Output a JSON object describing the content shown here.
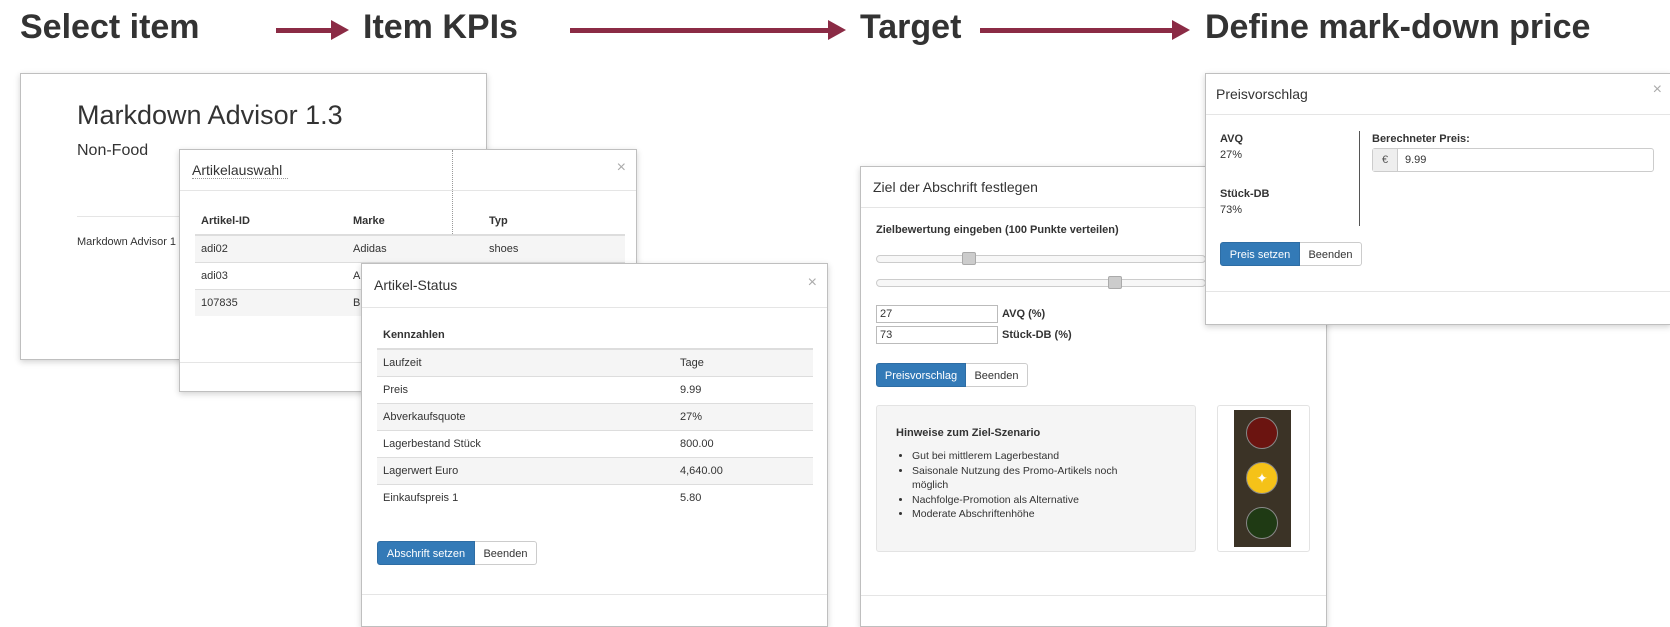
{
  "steps": [
    {
      "label": "Select item"
    },
    {
      "label": "Item KPIs"
    },
    {
      "label": "Target"
    },
    {
      "label": "Define mark-down price"
    }
  ],
  "colors": {
    "arrow": "#8b2b45",
    "primary_button": "#337ab7",
    "light_red": "#6b1410",
    "light_yellow": "#f5c218",
    "light_green": "#1f3a14"
  },
  "advisor": {
    "title": "Markdown Advisor 1.3",
    "subtitle": "Non-Food",
    "footer_text": "Markdown Advisor 1"
  },
  "artikelauswahl": {
    "title": "Artikelauswahl",
    "columns": [
      "Artikel-ID",
      "Marke",
      "Typ"
    ],
    "rows": [
      [
        "adi02",
        "Adidas",
        "shoes"
      ],
      [
        "adi03",
        "A",
        ""
      ],
      [
        "107835",
        "B",
        ""
      ]
    ]
  },
  "artikel_status": {
    "title": "Artikel-Status",
    "section_header": "Kennzahlen",
    "rows": [
      [
        "Laufzeit",
        "Tage"
      ],
      [
        "Preis",
        "9.99"
      ],
      [
        "Abverkaufsquote",
        "27%"
      ],
      [
        "Lagerbestand Stück",
        "800.00"
      ],
      [
        "Lagerwert Euro",
        "4,640.00"
      ],
      [
        "Einkaufspreis 1",
        "5.80"
      ]
    ],
    "btn_primary": "Abschrift setzen",
    "btn_secondary": "Beenden"
  },
  "ziel": {
    "title": "Ziel der Abschrift festlegen",
    "instruction": "Zielbewertung eingeben (100 Punkte verteilen)",
    "slider_avq_value": 27,
    "slider_db_value": 73,
    "avq_value": "27",
    "avq_label": "AVQ (%)",
    "db_value": "73",
    "db_label": "Stück-DB (%)",
    "btn_primary": "Preisvorschlag",
    "btn_secondary": "Beenden",
    "hint_title": "Hinweise zum Ziel-Szenario",
    "hints": [
      "Gut bei mittlerem Lagerbestand",
      "Saisonale Nutzung des Promo-Artikels noch möglich",
      "Nachfolge-Promotion als Alternative",
      "Moderate Abschriftenhöhe"
    ],
    "traffic_light_state": "yellow"
  },
  "preis": {
    "title": "Preisvorschlag",
    "avq_label": "AVQ",
    "avq_value": "27%",
    "db_label": "Stück-DB",
    "db_value": "73%",
    "computed_label": "Berechneter Preis:",
    "currency": "€",
    "price_value": "9.99",
    "btn_primary": "Preis setzen",
    "btn_secondary": "Beenden"
  },
  "icons": {
    "close": "×",
    "sparkle": "✦"
  }
}
